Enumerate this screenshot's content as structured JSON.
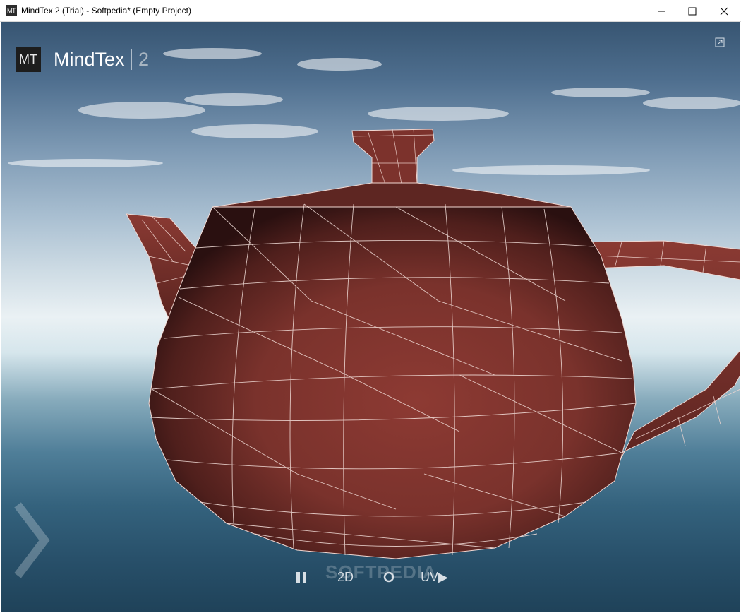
{
  "window": {
    "title": "MindTex 2 (Trial) - Softpedia* (Empty Project)",
    "icon_text": "MT"
  },
  "brand": {
    "logo_text": "MT",
    "name": "MindTex",
    "version": "2"
  },
  "toolbar": {
    "pause_icon": "pause-icon",
    "mode_2d_label": "2D",
    "cycle_icon": "cycle-icon",
    "uv_label": "UV▶"
  },
  "watermark": "SOFTPEDIA",
  "colors": {
    "teapot": "#8a3a33",
    "wire": "#f3dcd6",
    "accent_text": "#ffffff"
  }
}
